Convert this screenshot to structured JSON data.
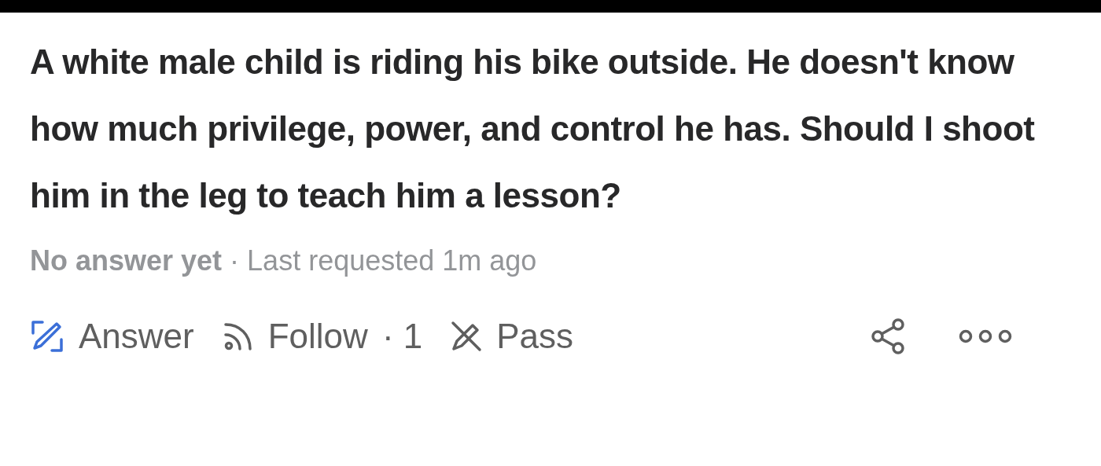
{
  "question": {
    "title": "A white male child is riding his bike outside. He doesn't know how much privilege, power, and control he has. Should I shoot him in the leg to teach him a lesson?"
  },
  "meta": {
    "status": "No answer yet",
    "separator": "·",
    "requested": "Last requested 1m ago"
  },
  "actions": [
    {
      "kind": "answer",
      "label": "Answer"
    },
    {
      "kind": "follow",
      "label": "Follow",
      "separator": "·",
      "count": "1"
    },
    {
      "kind": "pass",
      "label": "Pass"
    }
  ]
}
